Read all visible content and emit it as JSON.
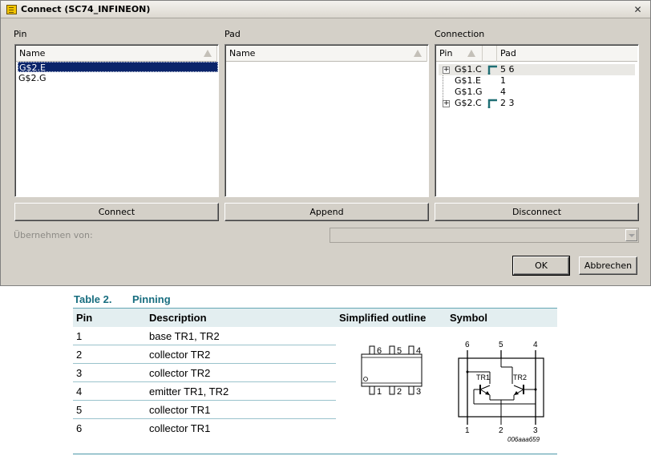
{
  "window": {
    "title": "Connect  (SC74_INFINEON)",
    "close_glyph": "✕"
  },
  "pin": {
    "label": "Pin",
    "column": "Name",
    "items": [
      "G$2.E",
      "G$2.G"
    ],
    "selected_index": 0
  },
  "pad": {
    "label": "Pad",
    "column": "Name",
    "items": []
  },
  "connection": {
    "label": "Connection",
    "columns": [
      "Pin",
      "Pad"
    ],
    "rows": [
      {
        "pin": "G$1.C",
        "pad": "5 6",
        "expandable": true,
        "connected_icon": true
      },
      {
        "pin": "G$1.E",
        "pad": "1",
        "expandable": false,
        "connected_icon": false
      },
      {
        "pin": "G$1.G",
        "pad": "4",
        "expandable": false,
        "connected_icon": false
      },
      {
        "pin": "G$2.C",
        "pad": "2 3",
        "expandable": true,
        "connected_icon": true
      }
    ]
  },
  "buttons": {
    "connect": "Connect",
    "append": "Append",
    "disconnect": "Disconnect",
    "ok": "OK",
    "cancel": "Abbrechen"
  },
  "take_from": {
    "label": "Übernehmen von:",
    "value": ""
  },
  "datasheet": {
    "table_number": "Table 2.",
    "table_title": "Pinning",
    "headers": [
      "Pin",
      "Description",
      "Simplified outline",
      "Symbol"
    ],
    "rows": [
      {
        "pin": "1",
        "description": "base TR1, TR2"
      },
      {
        "pin": "2",
        "description": "collector TR2"
      },
      {
        "pin": "3",
        "description": "collector TR2"
      },
      {
        "pin": "4",
        "description": "emitter TR1, TR2"
      },
      {
        "pin": "5",
        "description": "collector TR1"
      },
      {
        "pin": "6",
        "description": "collector TR1"
      }
    ],
    "outline": {
      "top_pins": [
        "6",
        "5",
        "4"
      ],
      "bottom_pins": [
        "1",
        "2",
        "3"
      ]
    },
    "symbol": {
      "top_pins": [
        "6",
        "5",
        "4"
      ],
      "bottom_pins": [
        "1",
        "2",
        "3"
      ],
      "transistors": [
        "TR1",
        "TR2"
      ],
      "figure_code": "006aaa659"
    }
  },
  "colors": {
    "dialog_bg": "#d4d0c8",
    "selection": "#0a246a",
    "table_accent": "#176d7f",
    "table_header_bg": "#e3eef0",
    "connection_icon": "#1e6e74"
  }
}
